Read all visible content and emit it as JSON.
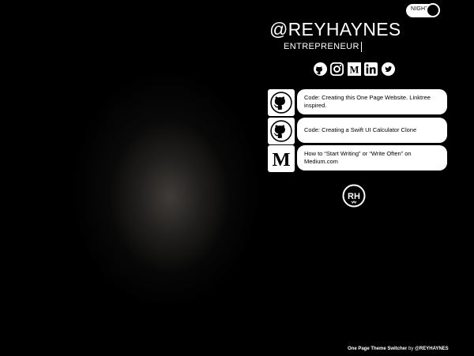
{
  "theme_toggle": {
    "label": "NIGHT"
  },
  "profile": {
    "handle": "@REYHAYNES",
    "role": "ENTREPRENEUR"
  },
  "socials": [
    {
      "icon": "github-icon"
    },
    {
      "icon": "instagram-icon"
    },
    {
      "icon": "medium-icon"
    },
    {
      "icon": "linkedin-icon"
    },
    {
      "icon": "twitter-icon"
    }
  ],
  "links": [
    {
      "icon": "github-icon",
      "title": "Code: Creating this One Page Website. Linktree inspired."
    },
    {
      "icon": "github-icon",
      "title": "Code: Creating a Swift UI Calculator Clone"
    },
    {
      "icon": "medium-icon",
      "title": "How to “Start Writing” or “Write Often” on Medium.com"
    }
  ],
  "brand": {
    "monogram": "RH"
  },
  "footer": {
    "text": "One Page Theme Switcher",
    "by": "by",
    "author": "@REYHAYNES"
  }
}
